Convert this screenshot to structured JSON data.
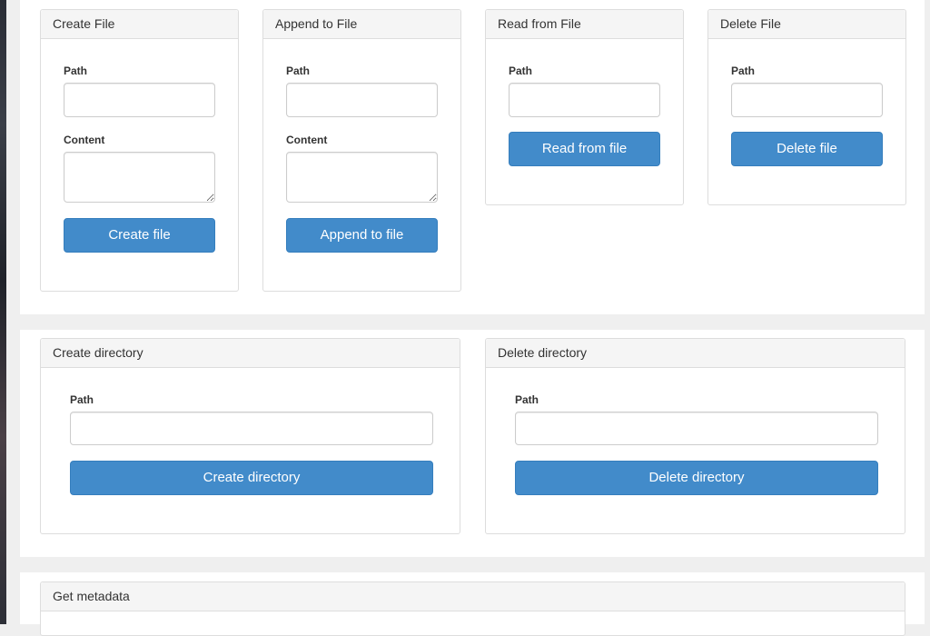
{
  "file_ops": {
    "create_file": {
      "heading": "Create File",
      "path_label": "Path",
      "path_value": "",
      "content_label": "Content",
      "content_value": "",
      "button_label": "Create file"
    },
    "append_file": {
      "heading": "Append to File",
      "path_label": "Path",
      "path_value": "",
      "content_label": "Content",
      "content_value": "",
      "button_label": "Append to file"
    },
    "read_file": {
      "heading": "Read from File",
      "path_label": "Path",
      "path_value": "",
      "button_label": "Read from file"
    },
    "delete_file": {
      "heading": "Delete File",
      "path_label": "Path",
      "path_value": "",
      "button_label": "Delete file"
    }
  },
  "dir_ops": {
    "create_dir": {
      "heading": "Create directory",
      "path_label": "Path",
      "path_value": "",
      "button_label": "Create directory"
    },
    "delete_dir": {
      "heading": "Delete directory",
      "path_label": "Path",
      "path_value": "",
      "button_label": "Delete directory"
    }
  },
  "metadata": {
    "heading": "Get metadata"
  },
  "colors": {
    "primary_button": "#428bca",
    "panel_heading_bg": "#f5f5f5",
    "page_bg": "#efefef"
  }
}
